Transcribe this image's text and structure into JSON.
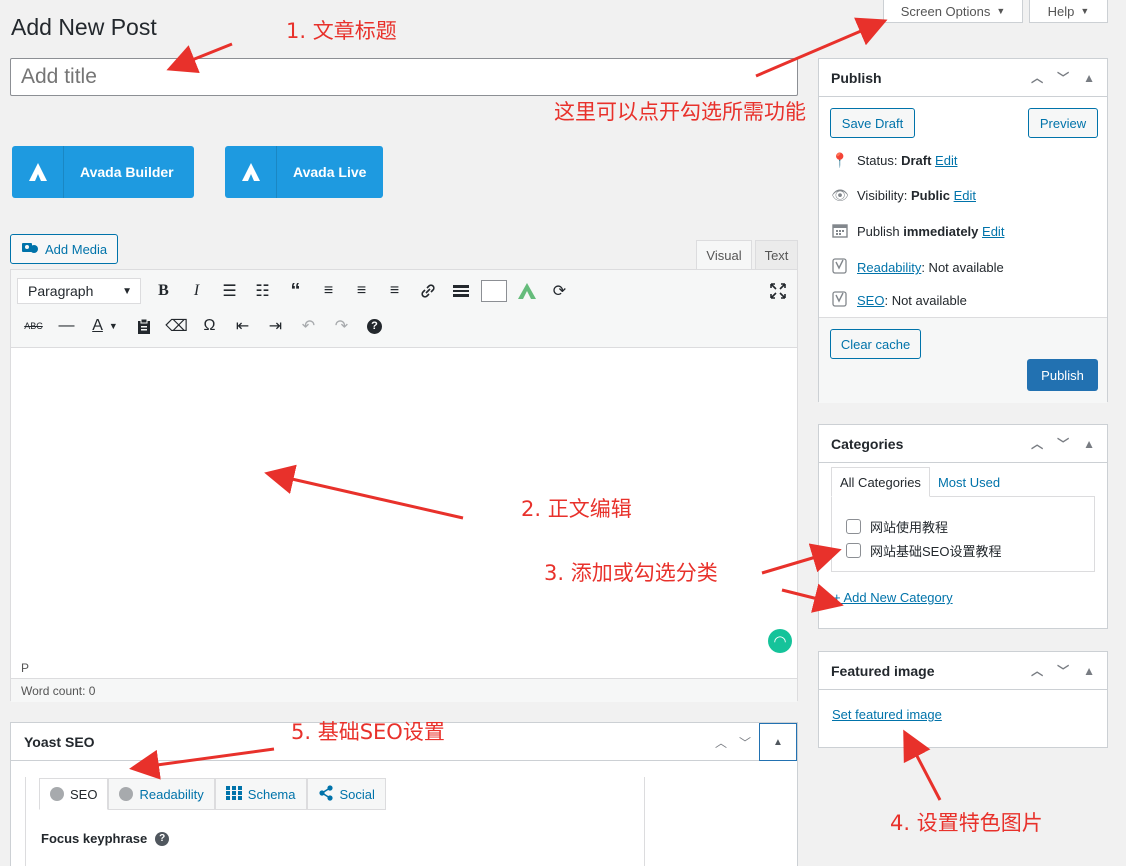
{
  "header": {
    "page_title": "Add New Post",
    "screen_options": "Screen Options",
    "help": "Help",
    "title_placeholder": "Add title"
  },
  "avada": {
    "builder_label": "Avada Builder",
    "live_label": "Avada Live"
  },
  "editor": {
    "add_media": "Add Media",
    "tab_visual": "Visual",
    "tab_text": "Text",
    "format_select": "Paragraph",
    "path": "P",
    "word_count": "Word count: 0"
  },
  "publish": {
    "title": "Publish",
    "save_draft": "Save Draft",
    "preview": "Preview",
    "status_label": "Status: ",
    "status_value": "Draft",
    "visibility_label": "Visibility: ",
    "visibility_value": "Public",
    "publish_label": "Publish ",
    "publish_value": "immediately",
    "edit": "Edit",
    "readability_link": "Readability",
    "readability_value": ": Not available",
    "seo_link": "SEO",
    "seo_value": ": Not available",
    "clear_cache": "Clear cache",
    "publish_button": "Publish"
  },
  "categories": {
    "title": "Categories",
    "tab_all": "All Categories",
    "tab_most_used": "Most Used",
    "items": [
      "网站使用教程",
      "网站基础SEO设置教程"
    ],
    "add_new": "+ Add New Category"
  },
  "featured_image": {
    "title": "Featured image",
    "link": "Set featured image"
  },
  "yoast": {
    "title": "Yoast SEO",
    "tabs": [
      "SEO",
      "Readability",
      "Schema",
      "Social"
    ],
    "focus_keyphrase": "Focus keyphrase"
  },
  "annotations": {
    "a1": "1. 文章标题",
    "a_screen": "这里可以点开勾选所需功能",
    "a2": "2. 正文编辑",
    "a3": "3. 添加或勾选分类",
    "a4": "4. 设置特色图片",
    "a5": "5. 基础SEO设置"
  },
  "colors": {
    "accent": "#0073aa",
    "primary_button": "#2271b1",
    "avada_blue": "#1e9ae0",
    "annotation_red": "#e8312b"
  }
}
